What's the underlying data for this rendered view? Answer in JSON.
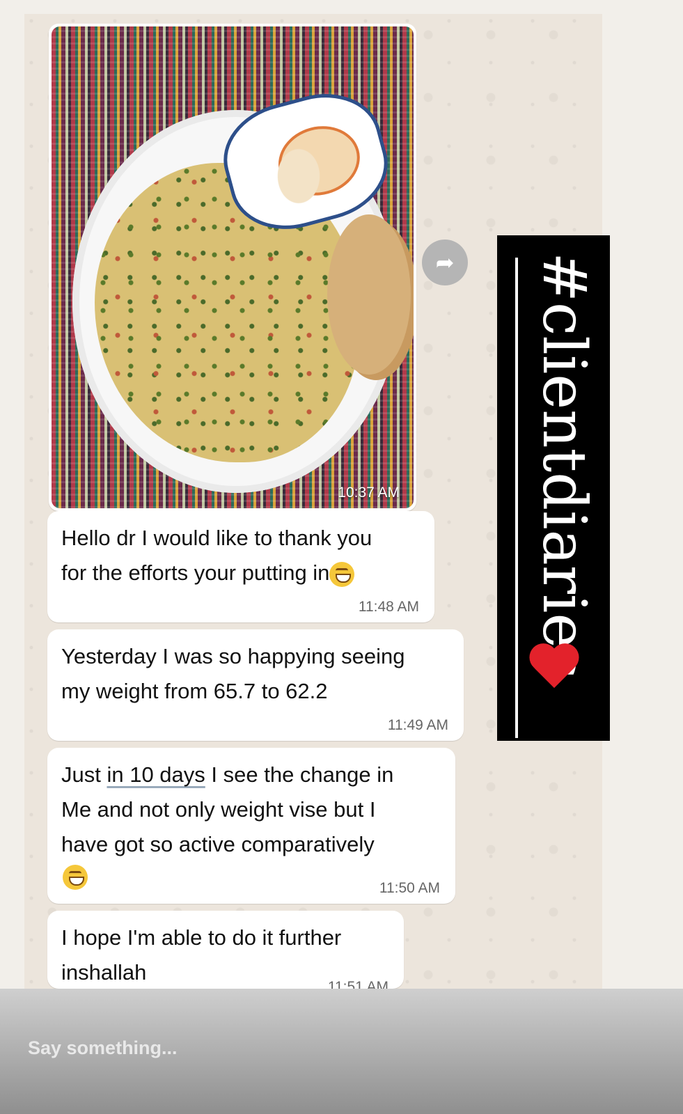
{
  "photo_message": {
    "time": "10:37 AM"
  },
  "forward_icon": "forward-arrow",
  "messages": [
    {
      "text": "Hello dr I would like to thank you\nfor the efforts your putting in",
      "emoji": "grinning-face",
      "time": "11:48 AM"
    },
    {
      "text": "Yesterday I was so happying seeing\nmy weight from 65.7 to 62.2",
      "time": "11:49 AM"
    },
    {
      "text_before": "Just ",
      "text_link": "in 10 days",
      "text_after": " I see the change in\nMe and not only weight vise but I\nhave got so active comparatively",
      "emoji": "grinning-face",
      "time": "11:50 AM"
    },
    {
      "text": "I hope I'm able to do it further\ninshallah",
      "time": "11:51 AM"
    }
  ],
  "banner": {
    "text": "#clientdiaries",
    "emoji": "red-heart"
  },
  "reply": {
    "placeholder": "Say something..."
  },
  "colors": {
    "bubble": "#ffffff",
    "banner_bg": "#000000",
    "heart": "#e3222b",
    "chat_bg": "#ece5dc"
  }
}
